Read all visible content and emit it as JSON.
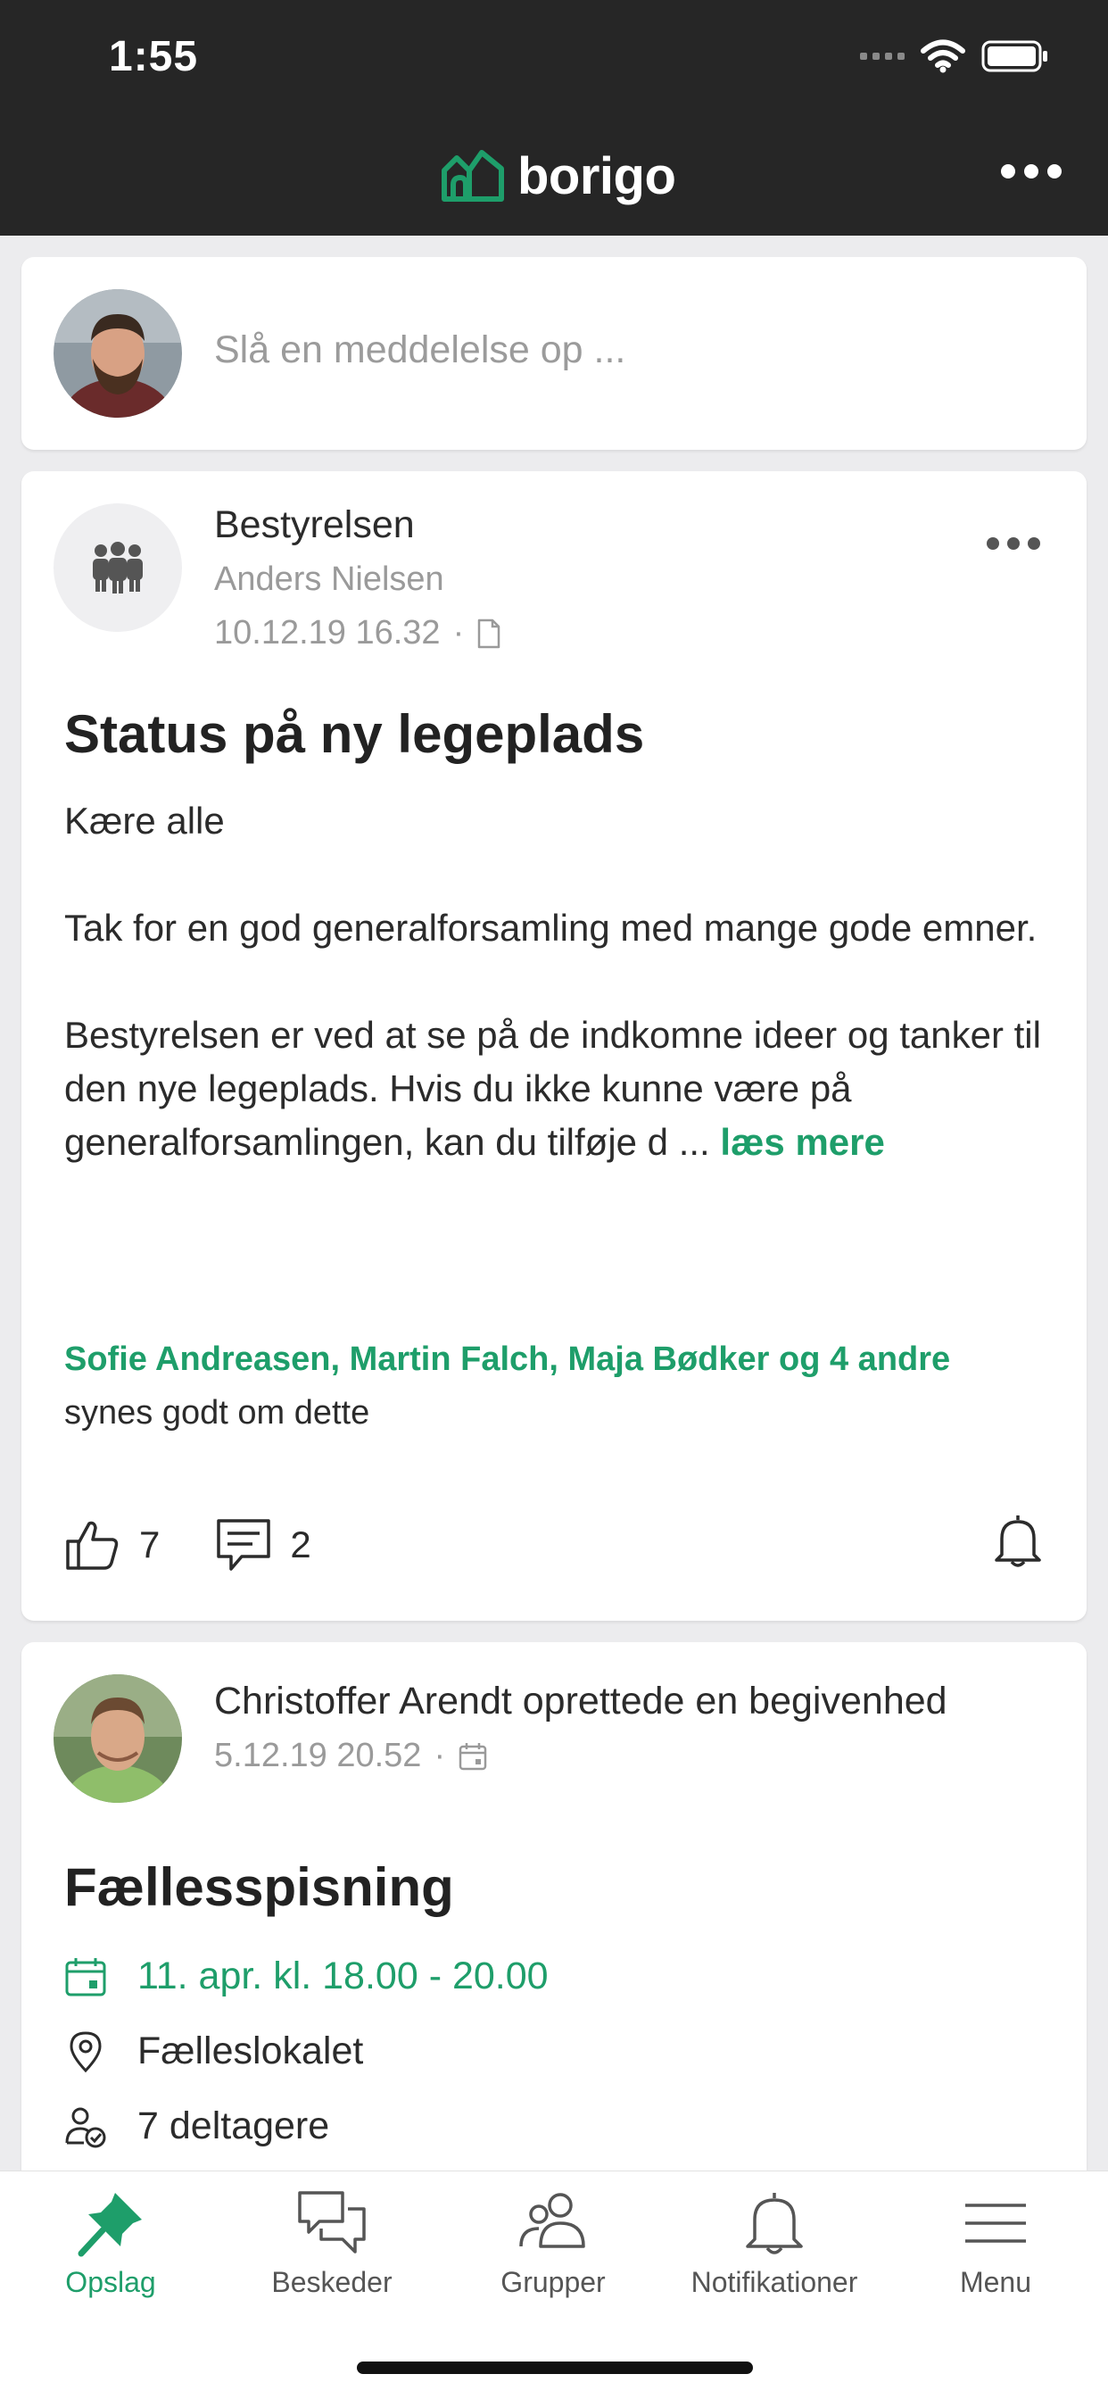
{
  "status_bar": {
    "time": "1:55"
  },
  "header": {
    "logo_text": "borigo",
    "brand_color": "#1e9e6a"
  },
  "composer": {
    "placeholder": "Slå en meddelelse op ..."
  },
  "post": {
    "group": "Bestyrelsen",
    "author": "Anders Nielsen",
    "timestamp": "10.12.19 16.32",
    "separator": "·",
    "title": "Status på ny legeplads",
    "body": [
      "Kære alle",
      "Tak for en god generalforsamling med mange gode emner.",
      "Bestyrelsen er ved at se på de indkomne ideer og tanker til den nye legeplads. Hvis du ikke kunne være på generalforsamlingen, kan du tilføje d ..."
    ],
    "read_more": "læs mere",
    "likers": "Sofie Andreasen, Martin Falch, Maja Bødker og 4 andre",
    "likers_suffix": "synes godt om dette",
    "likes": "7",
    "comments": "2"
  },
  "event": {
    "author_line": "Christoffer Arendt oprettede en begivenhed",
    "timestamp": "5.12.19 20.52",
    "separator": "·",
    "title": "Fællesspisning",
    "datetime": "11. apr. kl. 18.00 - 20.00",
    "location": "Fælleslokalet",
    "participants": "7 deltagere"
  },
  "tabs": [
    {
      "label": "Opslag",
      "icon": "pin-icon",
      "active": true
    },
    {
      "label": "Beskeder",
      "icon": "chat-bubbles-icon",
      "active": false
    },
    {
      "label": "Grupper",
      "icon": "group-icon",
      "active": false
    },
    {
      "label": "Notifikationer",
      "icon": "bell-icon",
      "active": false
    },
    {
      "label": "Menu",
      "icon": "menu-icon",
      "active": false
    }
  ]
}
